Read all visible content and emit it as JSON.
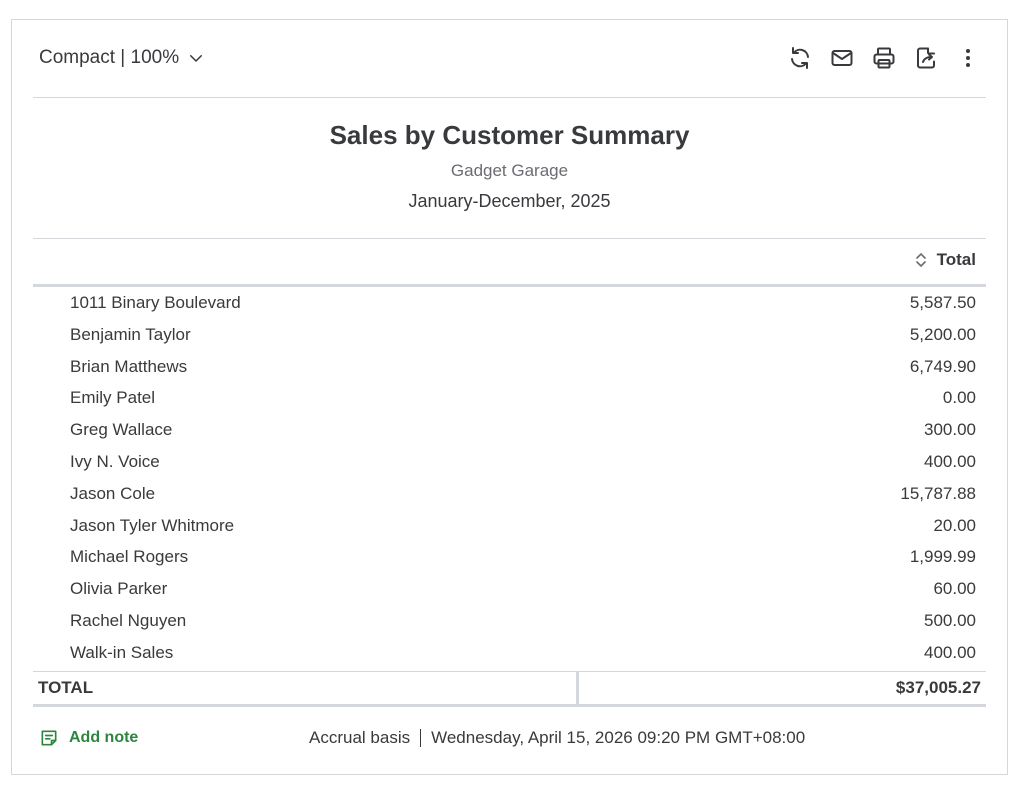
{
  "toolbar": {
    "view_label": "Compact | 100%",
    "icons": [
      "refresh-icon",
      "email-icon",
      "print-icon",
      "export-icon",
      "more-icon"
    ]
  },
  "report": {
    "title": "Sales by Customer Summary",
    "company": "Gadget Garage",
    "period": "January-December, 2025",
    "column_header": "Total",
    "rows": [
      {
        "name": "1011 Binary Boulevard",
        "amount": "5,587.50"
      },
      {
        "name": "Benjamin Taylor",
        "amount": "5,200.00"
      },
      {
        "name": "Brian Matthews",
        "amount": "6,749.90"
      },
      {
        "name": "Emily Patel",
        "amount": "0.00"
      },
      {
        "name": "Greg Wallace",
        "amount": "300.00"
      },
      {
        "name": "Ivy N. Voice",
        "amount": "400.00"
      },
      {
        "name": "Jason Cole",
        "amount": "15,787.88"
      },
      {
        "name": "Jason Tyler Whitmore",
        "amount": "20.00"
      },
      {
        "name": "Michael Rogers",
        "amount": "1,999.99"
      },
      {
        "name": "Olivia Parker",
        "amount": "60.00"
      },
      {
        "name": "Rachel Nguyen",
        "amount": "500.00"
      },
      {
        "name": "Walk-in Sales",
        "amount": "400.00"
      }
    ],
    "total_label": "TOTAL",
    "total_amount": "$37,005.27"
  },
  "footer": {
    "add_note": "Add note",
    "basis": "Accrual basis",
    "timestamp": "Wednesday, April 15, 2026 09:20 PM GMT+08:00"
  },
  "colors": {
    "accent_green": "#2e8540",
    "text": "#393a3d",
    "border": "#d4d7dc"
  }
}
